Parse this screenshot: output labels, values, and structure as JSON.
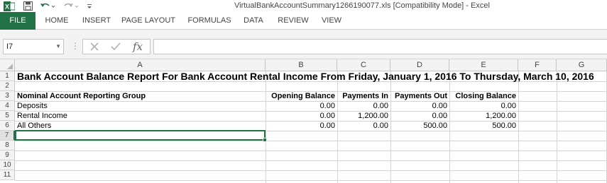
{
  "app": {
    "document_title": "VirtualBankAccountSummary1266190077.xls  [Compatibility Mode] - Excel",
    "brand_color": "#217346",
    "quick_access": {
      "icons": [
        "excel-icon",
        "save-icon",
        "undo-icon",
        "redo-icon",
        "customize-icon"
      ]
    }
  },
  "ribbon": {
    "tabs": [
      "FILE",
      "HOME",
      "INSERT",
      "PAGE LAYOUT",
      "FORMULAS",
      "DATA",
      "REVIEW",
      "VIEW"
    ],
    "active_tab": "FILE"
  },
  "formula_bar": {
    "name_box": "I7",
    "fx_label": "fx",
    "formula": ""
  },
  "sheet": {
    "columns": [
      "A",
      "B",
      "C",
      "D",
      "E",
      "F",
      "G"
    ],
    "rows": [
      "1",
      "2",
      "3",
      "4",
      "5",
      "6",
      "7",
      "8",
      "9",
      "10",
      "11"
    ],
    "active_row": "7",
    "title": "Bank Account Balance Report For Bank Account Rental Income From Friday, January 1, 2016  To Thursday, March 10, 2016",
    "headers": [
      "Nominal Account Reporting Group",
      "Opening Balance",
      "Payments In",
      "Payments Out",
      "Closing Balance"
    ],
    "data_rows": [
      [
        "Deposits",
        "0.00",
        "0.00",
        "0.00",
        "0.00"
      ],
      [
        "Rental Income",
        "0.00",
        "1,200.00",
        "0.00",
        "1,200.00"
      ],
      [
        "All Others",
        "0.00",
        "0.00",
        "500.00",
        "500.00"
      ]
    ]
  }
}
